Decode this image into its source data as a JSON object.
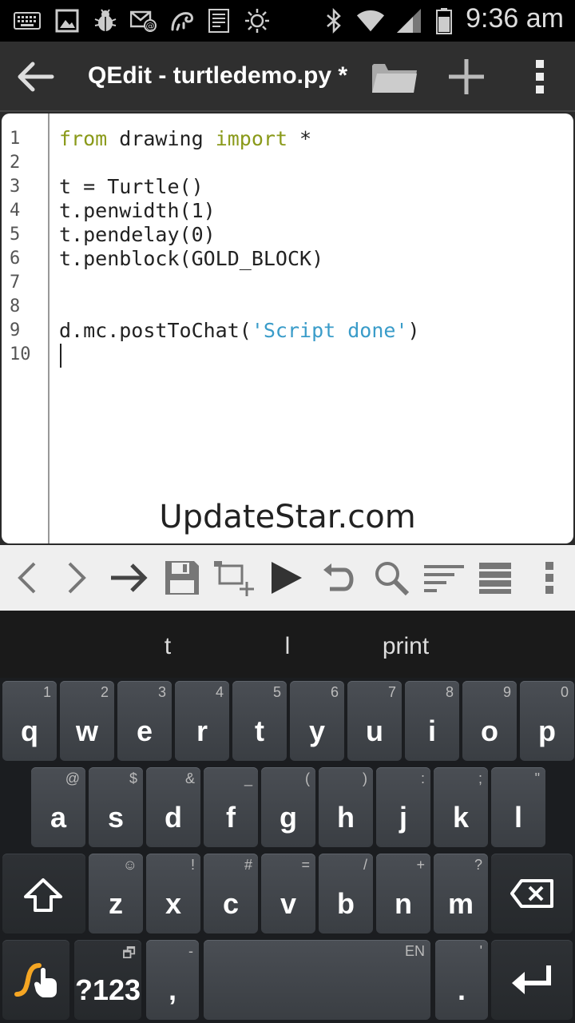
{
  "status_bar": {
    "time": "9:36 am",
    "left_icons": [
      "keyboard-icon",
      "picture-icon",
      "bug-icon",
      "email-at-icon",
      "chameleon-icon",
      "notes-icon",
      "brightness-icon"
    ],
    "right_icons": [
      "bluetooth-icon",
      "wifi-icon",
      "signal-icon",
      "battery-icon"
    ]
  },
  "action_bar": {
    "title": "QEdit - turtledemo.py *",
    "back_icon": "back-arrow-icon",
    "buttons": [
      "folder-icon",
      "plus-icon",
      "overflow-menu-icon"
    ]
  },
  "editor": {
    "lines": [
      {
        "num": "1",
        "parts": [
          {
            "t": "from",
            "c": "kw"
          },
          {
            "t": " drawing ",
            "c": ""
          },
          {
            "t": "import",
            "c": "kw"
          },
          {
            "t": " *",
            "c": ""
          }
        ]
      },
      {
        "num": "2",
        "parts": []
      },
      {
        "num": "3",
        "parts": [
          {
            "t": "t = Turtle()",
            "c": ""
          }
        ]
      },
      {
        "num": "4",
        "parts": [
          {
            "t": "t.penwidth(1)",
            "c": ""
          }
        ]
      },
      {
        "num": "5",
        "parts": [
          {
            "t": "t.pendelay(0)",
            "c": ""
          }
        ]
      },
      {
        "num": "6",
        "parts": [
          {
            "t": "t.penblock(GOLD_BLOCK)",
            "c": ""
          }
        ]
      },
      {
        "num": "7",
        "parts": []
      },
      {
        "num": "8",
        "parts": []
      },
      {
        "num": "9",
        "parts": [
          {
            "t": "d.mc.postToChat(",
            "c": ""
          },
          {
            "t": "'Script done'",
            "c": "str"
          },
          {
            "t": ")",
            "c": ""
          }
        ]
      },
      {
        "num": "10",
        "parts": []
      }
    ],
    "watermark": "UpdateStar.com"
  },
  "toolbar": {
    "buttons": [
      "chevron-left-icon",
      "chevron-right-icon",
      "goto-arrow-icon",
      "save-icon",
      "add-tab-icon",
      "run-icon",
      "undo-icon",
      "search-icon",
      "format-icon",
      "list-icon",
      "toolbar-overflow-icon"
    ]
  },
  "keyboard": {
    "suggestions": [
      "t",
      "l",
      "print"
    ],
    "row1": [
      {
        "k": "q",
        "h": "1"
      },
      {
        "k": "w",
        "h": "2"
      },
      {
        "k": "e",
        "h": "3"
      },
      {
        "k": "r",
        "h": "4"
      },
      {
        "k": "t",
        "h": "5"
      },
      {
        "k": "y",
        "h": "6"
      },
      {
        "k": "u",
        "h": "7"
      },
      {
        "k": "i",
        "h": "8"
      },
      {
        "k": "o",
        "h": "9"
      },
      {
        "k": "p",
        "h": "0"
      }
    ],
    "row2": [
      {
        "k": "a",
        "h": "@"
      },
      {
        "k": "s",
        "h": "$"
      },
      {
        "k": "d",
        "h": "&"
      },
      {
        "k": "f",
        "h": "_"
      },
      {
        "k": "g",
        "h": "("
      },
      {
        "k": "h",
        "h": ")"
      },
      {
        "k": "j",
        "h": ":"
      },
      {
        "k": "k",
        "h": ";"
      },
      {
        "k": "l",
        "h": "\""
      }
    ],
    "row3": [
      {
        "k": "z",
        "h": "☺"
      },
      {
        "k": "x",
        "h": "!"
      },
      {
        "k": "c",
        "h": "#"
      },
      {
        "k": "v",
        "h": "="
      },
      {
        "k": "b",
        "h": "/"
      },
      {
        "k": "n",
        "h": "+"
      },
      {
        "k": "m",
        "h": "?"
      }
    ],
    "symbols_label": "?123",
    "comma": ",",
    "comma_hint": "-",
    "space_hint": "EN",
    "period": ".",
    "period_hint": "'"
  }
}
